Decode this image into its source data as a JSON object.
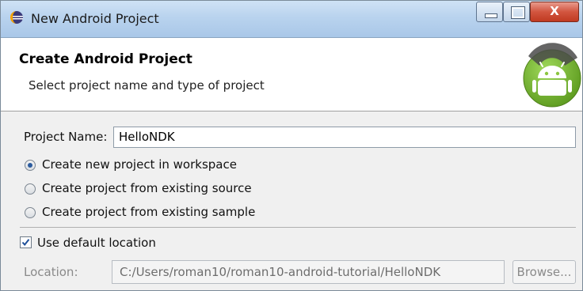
{
  "window": {
    "title": "New Android Project",
    "app_icon": "eclipse-icon",
    "controls": {
      "minimize": "minimize-icon",
      "maximize": "maximize-icon",
      "close_label": "X"
    }
  },
  "header": {
    "title": "Create Android Project",
    "subtitle": "Select project name and type of project",
    "logo": "android-logo-icon"
  },
  "form": {
    "project_name_label": "Project Name:",
    "project_name_value": "HelloNDK",
    "options": [
      {
        "label": "Create new project in workspace",
        "checked": true
      },
      {
        "label": "Create project from existing source",
        "checked": false
      },
      {
        "label": "Create project from existing sample",
        "checked": false
      }
    ],
    "use_default_location_label": "Use default location",
    "use_default_location_checked": true,
    "location_label": "Location:",
    "location_value": "C:/Users/roman10/roman10-android-tutorial/HelloNDK",
    "browse_label": "Browse..."
  },
  "colors": {
    "accent": "#2c5c9e",
    "android_green": "#8cc63f",
    "close_red": "#c03a21"
  }
}
